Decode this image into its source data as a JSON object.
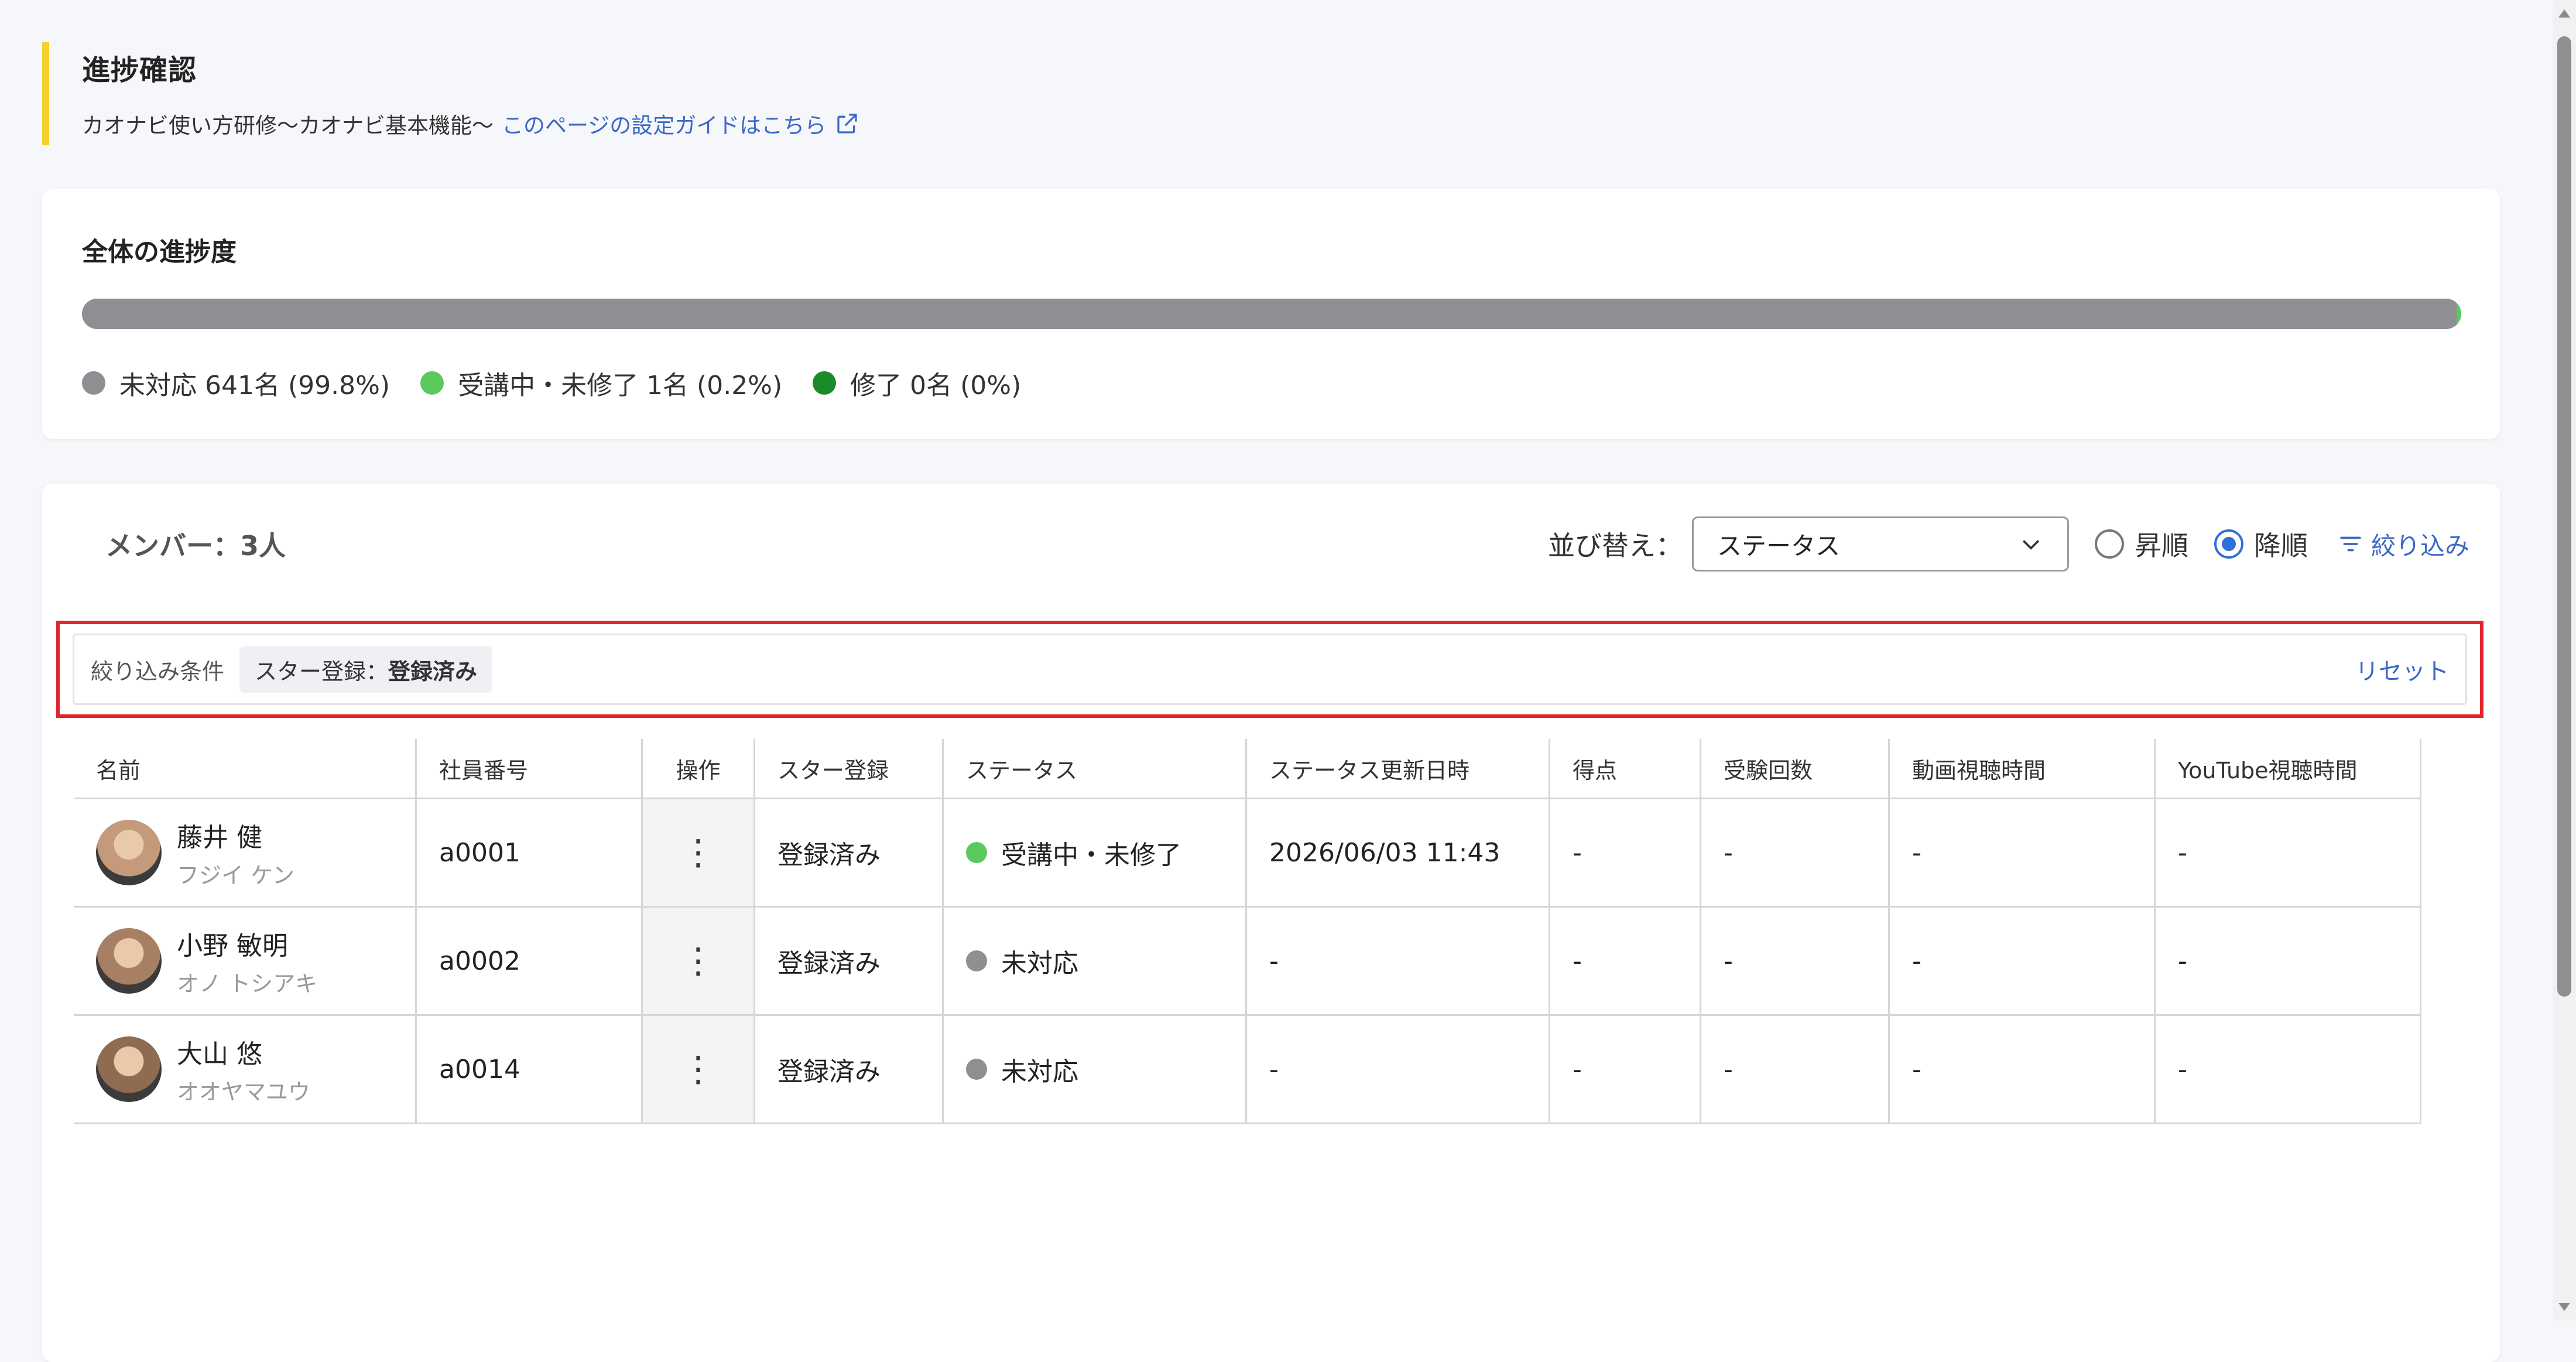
{
  "header": {
    "title": "進捗確認",
    "course_name": "カオナビ使い方研修〜カオナビ基本機能〜",
    "guide_link": "このページの設定ガイドはこちら",
    "accent_color": "#f6d02c"
  },
  "overall_progress": {
    "title": "全体の進捗度",
    "segments": [
      {
        "key": "not_started",
        "fraction": 0.998,
        "color": "#8e8e93"
      },
      {
        "key": "in_progress",
        "fraction": 0.002,
        "color": "#5cc95c"
      },
      {
        "key": "completed",
        "fraction": 0.0,
        "color": "#1a8a2a"
      }
    ],
    "legend": [
      {
        "label": "未対応 641名 (99.8%)",
        "color": "#8e8e93"
      },
      {
        "label": "受講中・未修了 1名 (0.2%)",
        "color": "#5cc95c"
      },
      {
        "label": "修了 0名 (0%)",
        "color": "#1a8a2a"
      }
    ]
  },
  "members": {
    "count_label": "メンバー：3人",
    "sort_label": "並び替え：",
    "sort_value": "ステータス",
    "order_options": [
      {
        "label": "昇順",
        "selected": false
      },
      {
        "label": "降順",
        "selected": true
      }
    ],
    "filter_link": "絞り込み",
    "filter_conditions_label": "絞り込み条件",
    "filter_chip_key": "スター登録：",
    "filter_chip_value": "登録済み",
    "reset_label": "リセット"
  },
  "table": {
    "columns": [
      "名前",
      "社員番号",
      "操作",
      "スター登録",
      "ステータス",
      "ステータス更新日時",
      "得点",
      "受験回数",
      "動画視聴時間",
      "YouTube視聴時間"
    ],
    "rows": [
      {
        "name": "藤井 健",
        "kana": "フジイ ケン",
        "emp": "a0001",
        "star": "登録済み",
        "status": "受講中・未修了",
        "status_color": "#5cc95c",
        "updated": "2026/06/03 11:43",
        "score": "-",
        "tries": "-",
        "video": "-",
        "yt": "-",
        "avatar_color": "#c49a7a",
        "op": "⋮"
      },
      {
        "name": "小野 敏明",
        "kana": "オノ トシアキ",
        "emp": "a0002",
        "star": "登録済み",
        "status": "未対応",
        "status_color": "#8e8e93",
        "updated": "-",
        "score": "-",
        "tries": "-",
        "video": "-",
        "yt": "-",
        "avatar_color": "#a77f63",
        "op": "⋮"
      },
      {
        "name": "大山 悠",
        "kana": "オオヤマユウ",
        "emp": "a0014",
        "star": "登録済み",
        "status": "未対応",
        "status_color": "#8e8e93",
        "updated": "-",
        "score": "-",
        "tries": "-",
        "video": "-",
        "yt": "-",
        "avatar_color": "#8f6b52",
        "op": "⋮"
      }
    ]
  }
}
